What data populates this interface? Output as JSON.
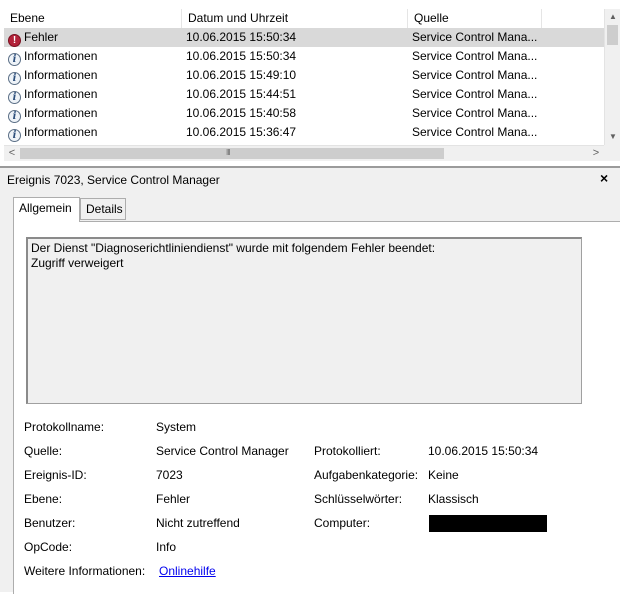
{
  "list": {
    "columns": [
      "Ebene",
      "Datum und Uhrzeit",
      "Quelle"
    ],
    "rows": [
      {
        "level": "Fehler",
        "icon": "error-icon",
        "date": "10.06.2015 15:50:34",
        "source": "Service Control Mana..."
      },
      {
        "level": "Informationen",
        "icon": "info-icon",
        "date": "10.06.2015 15:50:34",
        "source": "Service Control Mana..."
      },
      {
        "level": "Informationen",
        "icon": "info-icon",
        "date": "10.06.2015 15:49:10",
        "source": "Service Control Mana..."
      },
      {
        "level": "Informationen",
        "icon": "info-icon",
        "date": "10.06.2015 15:44:51",
        "source": "Service Control Mana..."
      },
      {
        "level": "Informationen",
        "icon": "info-icon",
        "date": "10.06.2015 15:40:58",
        "source": "Service Control Mana..."
      },
      {
        "level": "Informationen",
        "icon": "info-icon",
        "date": "10.06.2015 15:36:47",
        "source": "Service Control Mana..."
      }
    ]
  },
  "panel": {
    "title": "Ereignis 7023, Service Control Manager",
    "close": "×",
    "tabs": [
      "Allgemein",
      "Details"
    ],
    "message": "Der Dienst \"Diagnoserichtliniendienst\" wurde mit folgendem Fehler beendet:\nZugriff verweigert"
  },
  "props": {
    "logname_label": "Protokollname:",
    "logname": "System",
    "source_label": "Quelle:",
    "source": "Service Control Manager",
    "logged_label": "Protokolliert:",
    "logged": "10.06.2015 15:50:34",
    "eventid_label": "Ereignis-ID:",
    "eventid": "7023",
    "task_label": "Aufgabenkategorie:",
    "task": "Keine",
    "level_label": "Ebene:",
    "level": "Fehler",
    "keywords_label": "Schlüsselwörter:",
    "keywords": "Klassisch",
    "user_label": "Benutzer:",
    "user": "Nicht zutreffend",
    "computer_label": "Computer:",
    "opcode_label": "OpCode:",
    "opcode": "Info",
    "moreinfo_label": "Weitere Informationen:",
    "moreinfo_link": "Onlinehilfe"
  },
  "scrollbar": {
    "h_grip": "III",
    "up": "▲",
    "down": "▼",
    "left": "<",
    "right": ">"
  },
  "colors": {
    "selected_row": "#d9d9d9",
    "link": "#0000ee",
    "panel_bg": "#f0f0f0"
  }
}
